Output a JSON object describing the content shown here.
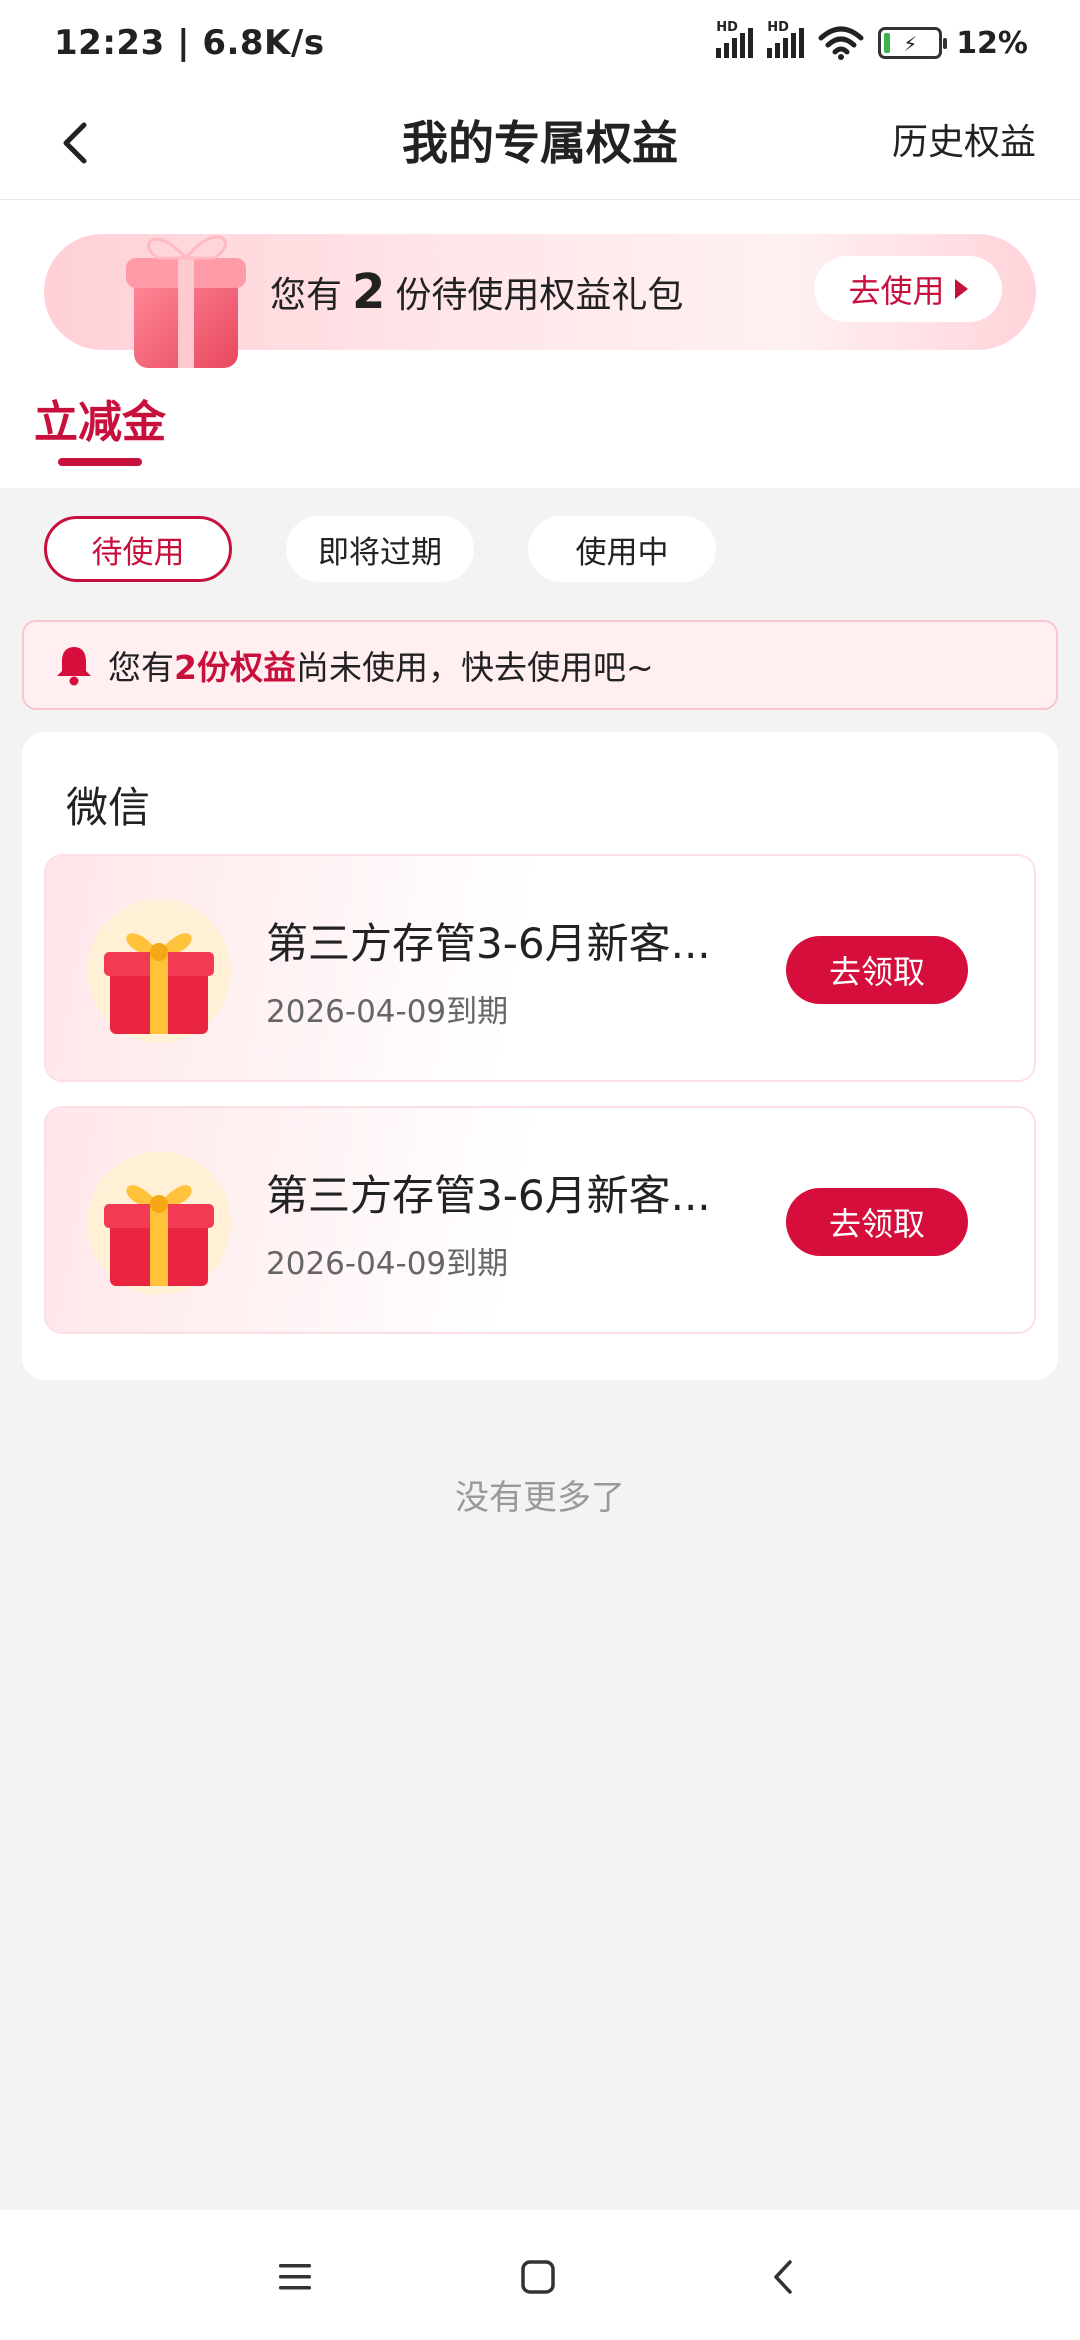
{
  "status_bar": {
    "time_speed": "12:23 | 6.8K/s",
    "signal_label": "HD",
    "battery_pct": "12%"
  },
  "header": {
    "title": "我的专属权益",
    "history_label": "历史权益"
  },
  "banner": {
    "prefix": "您有",
    "count": "2",
    "suffix": "份待使用权益礼包",
    "button_label": "去使用"
  },
  "category_tab": {
    "label": "立减金"
  },
  "filters": [
    {
      "label": "待使用",
      "active": true
    },
    {
      "label": "即将过期",
      "active": false
    },
    {
      "label": "使用中",
      "active": false
    }
  ],
  "notice": {
    "prefix": "您有",
    "highlight": "2份权益",
    "suffix": "尚未使用，快去使用吧~"
  },
  "section": {
    "title": "微信",
    "items": [
      {
        "title": "第三方存管3-6月新客...",
        "expiry": "2026-04-09到期",
        "button_label": "去领取"
      },
      {
        "title": "第三方存管3-6月新客...",
        "expiry": "2026-04-09到期",
        "button_label": "去领取"
      }
    ]
  },
  "footer": {
    "no_more": "没有更多了"
  },
  "colors": {
    "accent": "#c8103d",
    "claim_button": "#d50e3c",
    "page_bg": "#f3f3f3"
  },
  "icons": {
    "back": "chevron-left-icon",
    "bell": "bell-icon",
    "gift": "gift-icon",
    "nav_menu": "menu-icon",
    "nav_home": "home-square-icon",
    "nav_back": "back-chevron-icon"
  }
}
